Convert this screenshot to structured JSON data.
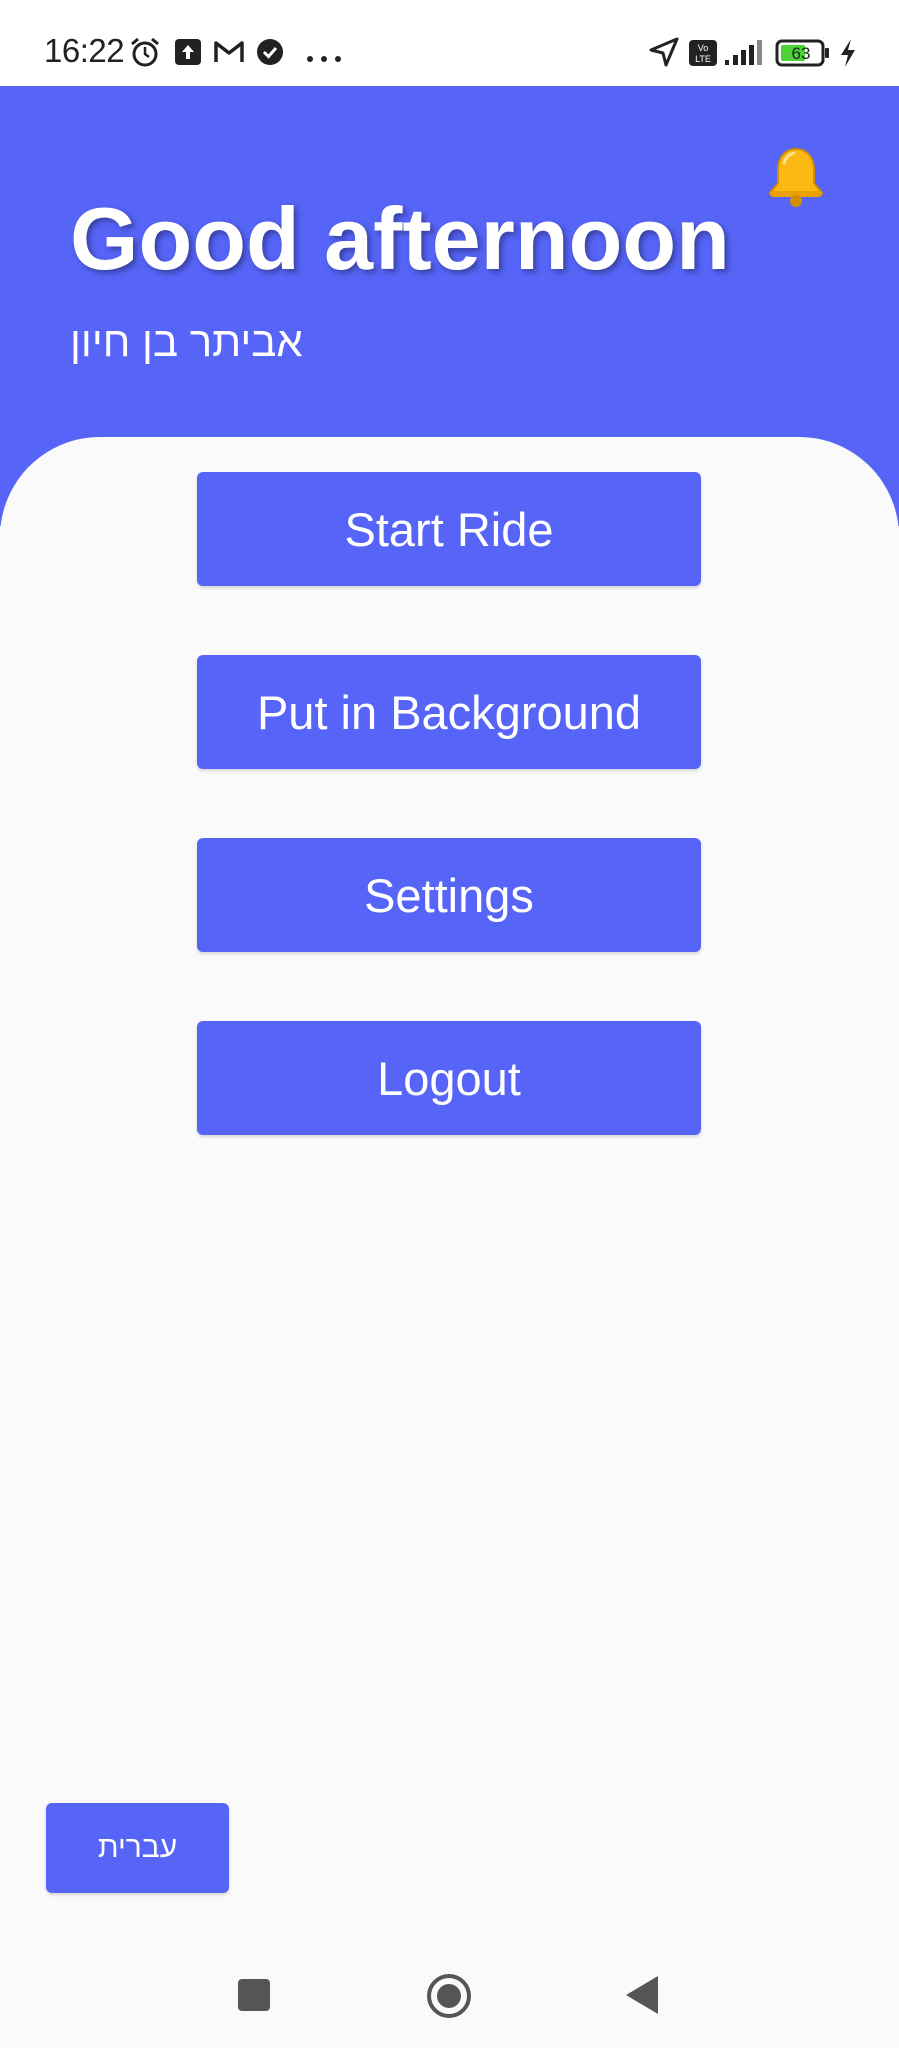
{
  "status_bar": {
    "time": "16:22",
    "battery_level": "63",
    "left_icons": [
      "alarm-icon",
      "upload-icon",
      "gmail-icon",
      "check-circle-icon",
      "more-dots-icon"
    ],
    "right_icons": [
      "location-arrow-icon",
      "volte-icon",
      "signal-icon",
      "battery-icon",
      "charging-bolt-icon"
    ]
  },
  "header": {
    "greeting": "Good afternoon",
    "user_name": "אביתר בן חיון",
    "notification_icon": "bell-icon",
    "bg_color": "#5664F7"
  },
  "menu": {
    "start_ride": "Start Ride",
    "put_in_background": "Put in Background",
    "settings": "Settings",
    "logout": "Logout"
  },
  "language_button": {
    "label": "עברית"
  },
  "nav_bar": {
    "icons": [
      "recent-apps-icon",
      "home-icon",
      "back-icon"
    ]
  }
}
